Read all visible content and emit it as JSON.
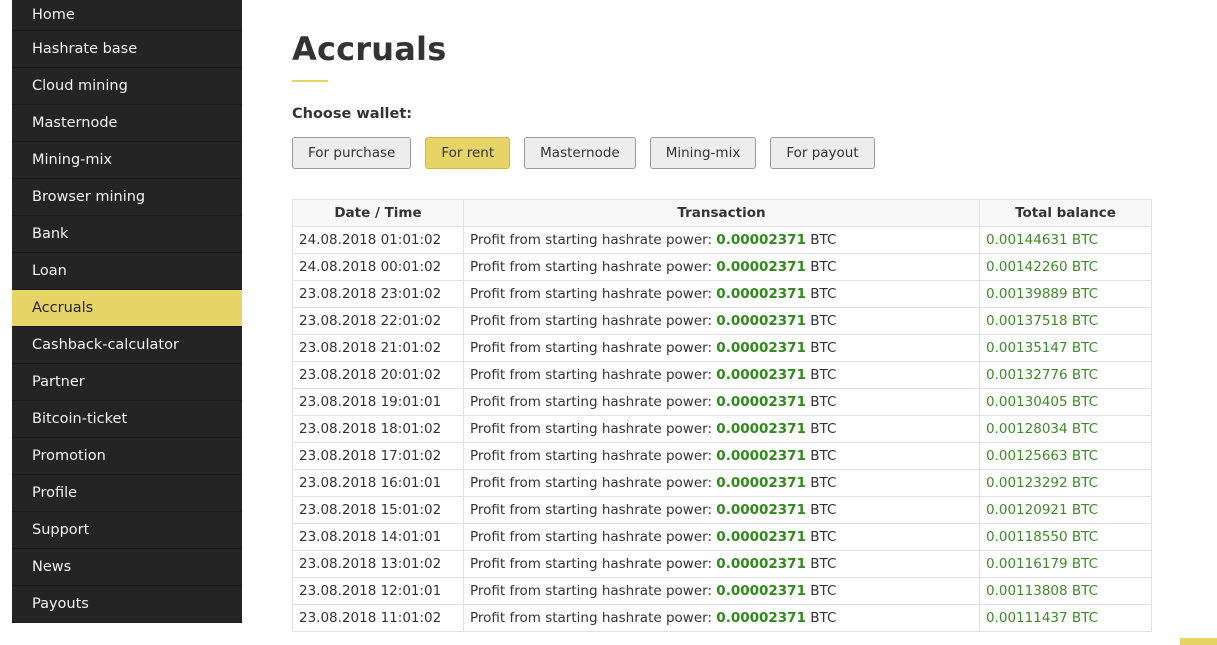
{
  "sidebar": {
    "items": [
      {
        "label": "Home",
        "active": false
      },
      {
        "label": "Hashrate base",
        "active": false
      },
      {
        "label": "Cloud mining",
        "active": false
      },
      {
        "label": "Masternode",
        "active": false
      },
      {
        "label": "Mining-mix",
        "active": false
      },
      {
        "label": "Browser mining",
        "active": false
      },
      {
        "label": "Bank",
        "active": false
      },
      {
        "label": "Loan",
        "active": false
      },
      {
        "label": "Accruals",
        "active": true
      },
      {
        "label": "Cashback-calculator",
        "active": false
      },
      {
        "label": "Partner",
        "active": false
      },
      {
        "label": "Bitcoin-ticket",
        "active": false
      },
      {
        "label": "Promotion",
        "active": false
      },
      {
        "label": "Profile",
        "active": false
      },
      {
        "label": "Support",
        "active": false
      },
      {
        "label": "News",
        "active": false
      },
      {
        "label": "Payouts",
        "active": false
      }
    ]
  },
  "page": {
    "title": "Accruals",
    "choose_label": "Choose wallet:"
  },
  "wallet_buttons": [
    {
      "label": "For purchase",
      "active": false
    },
    {
      "label": "For rent",
      "active": true
    },
    {
      "label": "Masternode",
      "active": false
    },
    {
      "label": "Mining-mix",
      "active": false
    },
    {
      "label": "For payout",
      "active": false
    }
  ],
  "table": {
    "headers": [
      "Date / Time",
      "Transaction",
      "Total balance"
    ],
    "tx_prefix": "Profit from starting hashrate power:",
    "currency": "BTC",
    "rows": [
      {
        "date": "24.08.2018 01:01:02",
        "amount": "0.00002371",
        "balance": "0.00144631 BTC"
      },
      {
        "date": "24.08.2018 00:01:02",
        "amount": "0.00002371",
        "balance": "0.00142260 BTC"
      },
      {
        "date": "23.08.2018 23:01:02",
        "amount": "0.00002371",
        "balance": "0.00139889 BTC"
      },
      {
        "date": "23.08.2018 22:01:02",
        "amount": "0.00002371",
        "balance": "0.00137518 BTC"
      },
      {
        "date": "23.08.2018 21:01:02",
        "amount": "0.00002371",
        "balance": "0.00135147 BTC"
      },
      {
        "date": "23.08.2018 20:01:02",
        "amount": "0.00002371",
        "balance": "0.00132776 BTC"
      },
      {
        "date": "23.08.2018 19:01:01",
        "amount": "0.00002371",
        "balance": "0.00130405 BTC"
      },
      {
        "date": "23.08.2018 18:01:02",
        "amount": "0.00002371",
        "balance": "0.00128034 BTC"
      },
      {
        "date": "23.08.2018 17:01:02",
        "amount": "0.00002371",
        "balance": "0.00125663 BTC"
      },
      {
        "date": "23.08.2018 16:01:01",
        "amount": "0.00002371",
        "balance": "0.00123292 BTC"
      },
      {
        "date": "23.08.2018 15:01:02",
        "amount": "0.00002371",
        "balance": "0.00120921 BTC"
      },
      {
        "date": "23.08.2018 14:01:01",
        "amount": "0.00002371",
        "balance": "0.00118550 BTC"
      },
      {
        "date": "23.08.2018 13:01:02",
        "amount": "0.00002371",
        "balance": "0.00116179 BTC"
      },
      {
        "date": "23.08.2018 12:01:01",
        "amount": "0.00002371",
        "balance": "0.00113808 BTC"
      },
      {
        "date": "23.08.2018 11:01:02",
        "amount": "0.00002371",
        "balance": "0.00111437 BTC"
      }
    ]
  },
  "colors": {
    "accent": "#e6d466",
    "sidebar_bg": "#242424",
    "amount_green": "#2e8b1a"
  }
}
